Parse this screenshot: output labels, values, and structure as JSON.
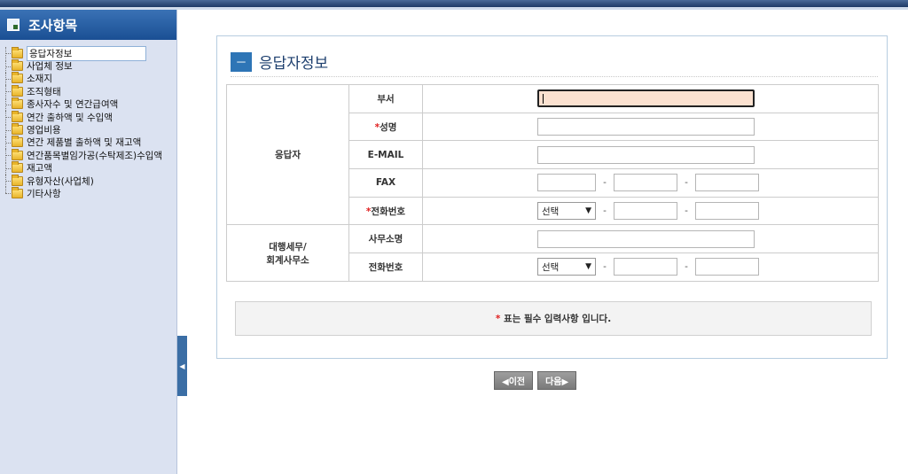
{
  "sidebar": {
    "title": "조사항목",
    "items": [
      {
        "label": "응답자정보"
      },
      {
        "label": "사업체 정보"
      },
      {
        "label": "소재지"
      },
      {
        "label": "조직형태"
      },
      {
        "label": "종사자수 및 연간급여액"
      },
      {
        "label": "연간 출하액 및 수입액"
      },
      {
        "label": "영업비용"
      },
      {
        "label": "연간 제품별 출하액 및 재고액"
      },
      {
        "label": "연간품목별임가공(수탁제조)수입액"
      },
      {
        "label": "재고액"
      },
      {
        "label": "유형자산(사업체)"
      },
      {
        "label": "기타사항"
      }
    ],
    "collapse_glyph": "◀"
  },
  "panel": {
    "minus_glyph": "－",
    "title": "응답자정보"
  },
  "form": {
    "respondent_group": "응답자",
    "agency_group_line1": "대행세무/",
    "agency_group_line2": "회계사무소",
    "required_mark": "*",
    "dept_label": "부서",
    "name_label": "성명",
    "email_label": "E-MAIL",
    "fax_label": "FAX",
    "phone_label": "전화번호",
    "office_label": "사무소명",
    "office_phone_label": "전화번호",
    "select_default": "선택",
    "dash": "-"
  },
  "notice": {
    "mark": "*",
    "text": " 표는 필수 입력사항 입니다."
  },
  "nav": {
    "prev": "◀이전",
    "next": "다음▶"
  }
}
